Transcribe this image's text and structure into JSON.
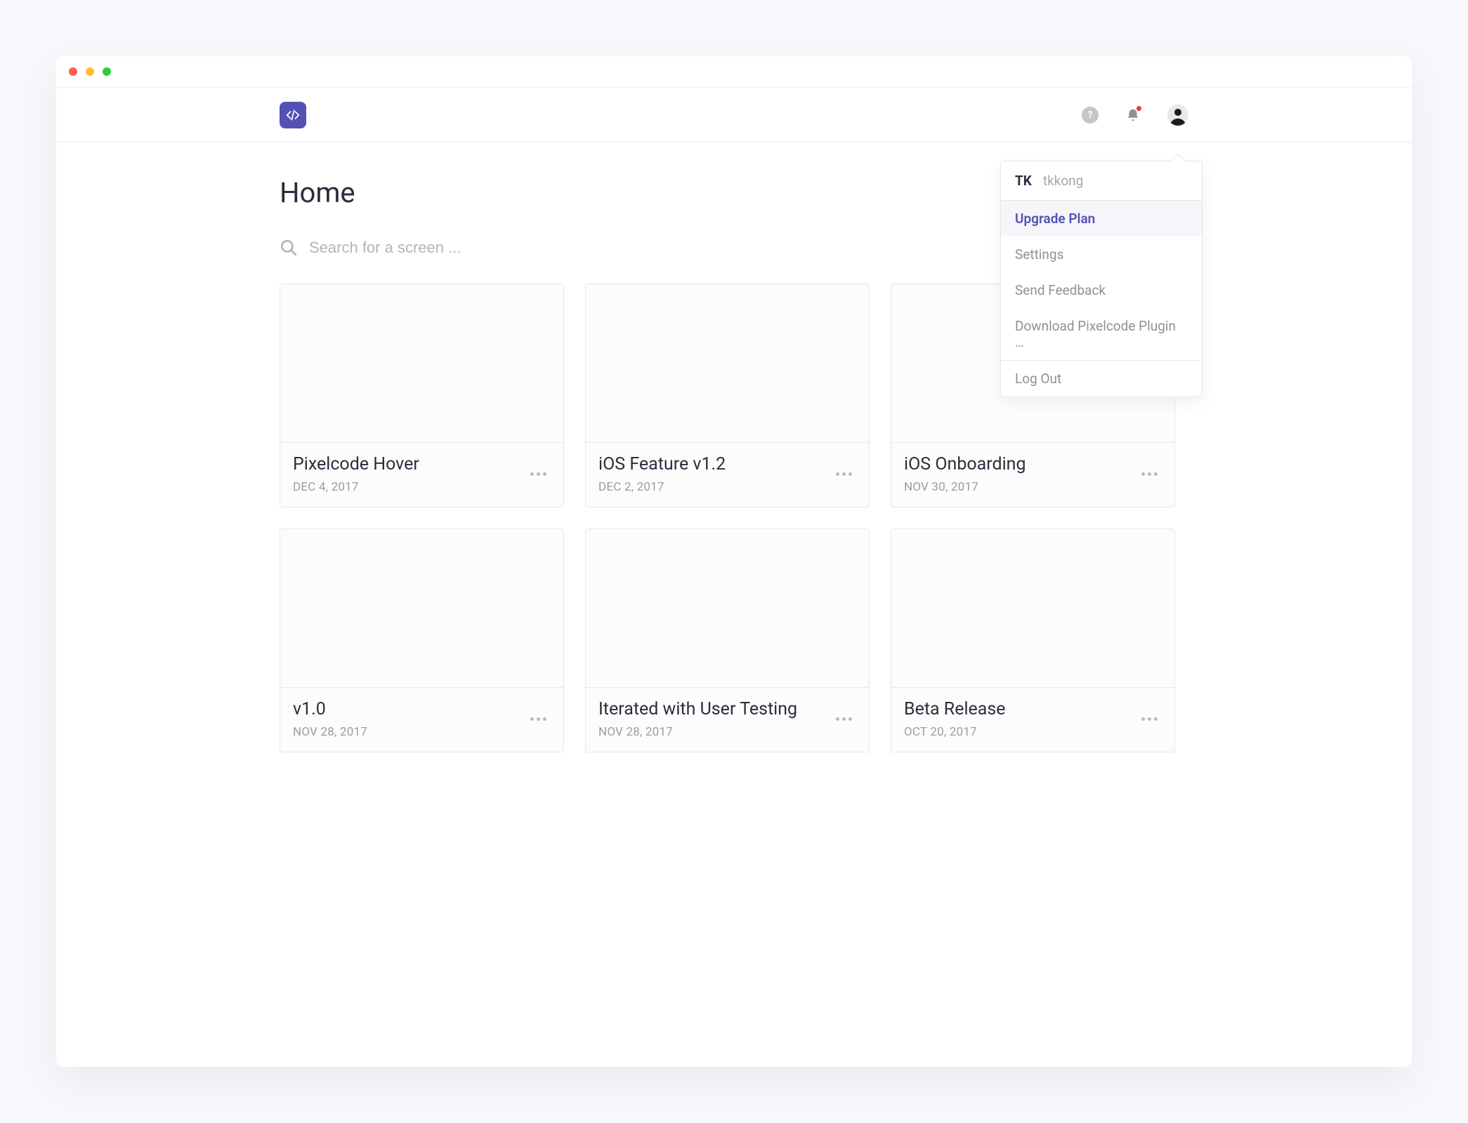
{
  "page": {
    "title": "Home"
  },
  "search": {
    "placeholder": "Search for a screen ..."
  },
  "user": {
    "initials": "TK",
    "username": "tkkong"
  },
  "menu": {
    "upgrade": "Upgrade Plan",
    "settings": "Settings",
    "feedback": "Send Feedback",
    "download": "Download Pixelcode Plugin …",
    "logout": "Log Out"
  },
  "cards": [
    {
      "title": "Pixelcode Hover",
      "date": "DEC 4, 2017"
    },
    {
      "title": "iOS Feature v1.2",
      "date": "DEC 2, 2017"
    },
    {
      "title": "iOS Onboarding",
      "date": "NOV 30, 2017"
    },
    {
      "title": "v1.0",
      "date": "NOV 28, 2017"
    },
    {
      "title": "Iterated with User Testing",
      "date": "NOV 28, 2017"
    },
    {
      "title": "Beta Release",
      "date": "OCT 20, 2017"
    }
  ]
}
